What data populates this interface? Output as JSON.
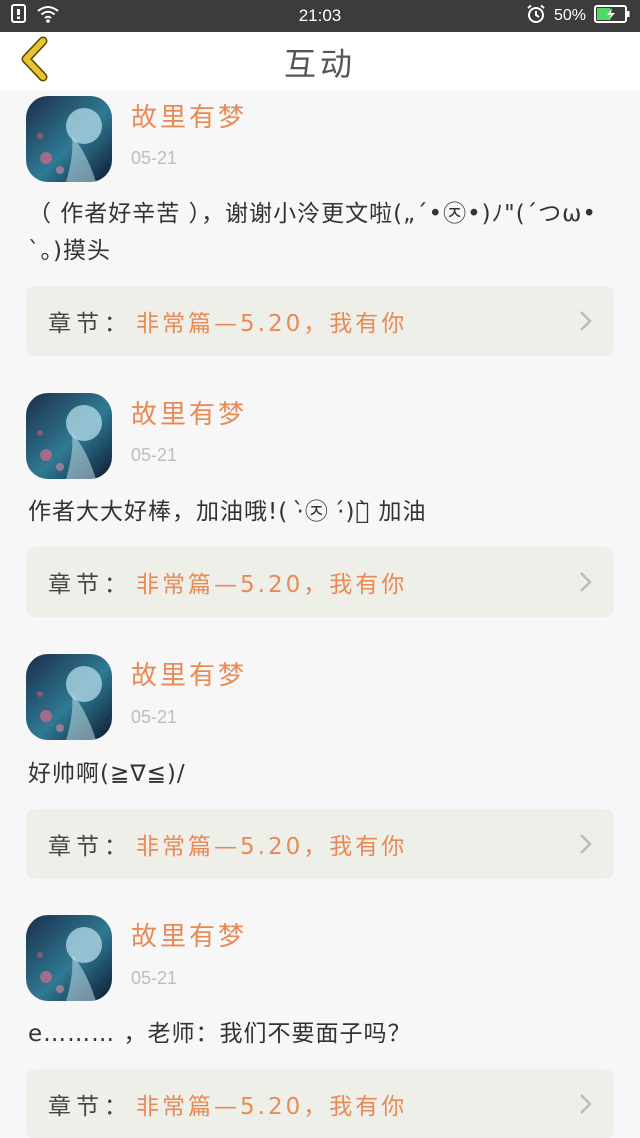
{
  "status_bar": {
    "time": "21:03",
    "battery_percent": "50%",
    "battery_level": 0.5
  },
  "nav": {
    "title": "互动",
    "back_icon": "chevron-left-icon"
  },
  "colors": {
    "accent": "#e88a55",
    "back_icon": "#e8c230",
    "chapter_bg": "#efefea",
    "date": "#bdbdbd"
  },
  "comments": [
    {
      "user": "故里有梦",
      "date": "05-21",
      "text": "（ 作者好辛苦 ），谢谢小泠更文啦(„ˊ•㉨•)ﾉ\"(ˊつω• ˋ。)摸头",
      "chapter_label": "章节：",
      "chapter_title": "非常篇—5.20，我有你"
    },
    {
      "user": "故里有梦",
      "date": "05-21",
      "text": "作者大大好棒，加油哦!( ·̀㉨ ·́)ง̀ 加油",
      "chapter_label": "章节：",
      "chapter_title": "非常篇—5.20，我有你"
    },
    {
      "user": "故里有梦",
      "date": "05-21",
      "text": "好帅啊(≧∇≦)/",
      "chapter_label": "章节：",
      "chapter_title": "非常篇—5.20，我有你"
    },
    {
      "user": "故里有梦",
      "date": "05-21",
      "text": "e……… ，老师：我们不要面子吗？",
      "chapter_label": "章节：",
      "chapter_title": "非常篇—5.20，我有你"
    }
  ]
}
